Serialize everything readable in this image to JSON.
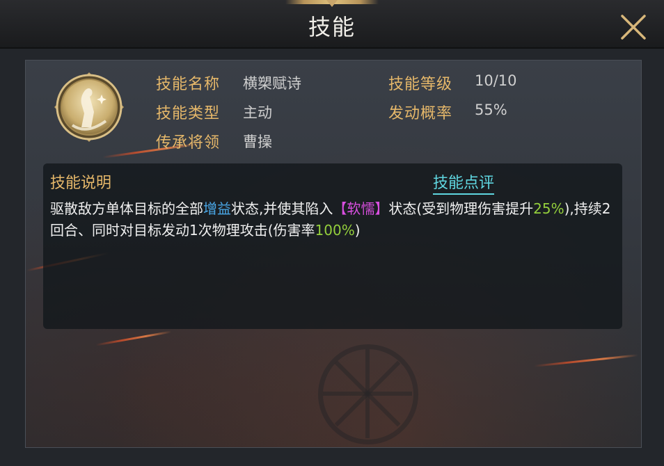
{
  "window": {
    "title": "技能"
  },
  "skill": {
    "icon": "skill-emblem-icon",
    "name_label": "技能名称",
    "name_value": "横槊赋诗",
    "type_label": "技能类型",
    "type_value": "主动",
    "heir_label": "传承将领",
    "heir_value": "曹操",
    "level_label": "技能等级",
    "level_value": "10/10",
    "rate_label": "发动概率",
    "rate_value": "55%"
  },
  "description": {
    "title": "技能说明",
    "review_link": "技能点评",
    "seg1": "驱散敌方单体目标的全部",
    "seg2": "增益",
    "seg3": "状态,并使其陷入",
    "seg4": "【软懦】",
    "seg5": "状态(受到物理伤害提升",
    "seg6": "25%",
    "seg7": "),持续2回合、同时对目标发动1次物理攻击(伤害率",
    "seg8": "100%",
    "seg9": ")"
  },
  "colors": {
    "label_gold": "#e6b86a",
    "buff_blue": "#4aa8e8",
    "status_pink": "#d94fe0",
    "number_green": "#94cf3c",
    "link_cyan": "#5fd6e0"
  }
}
